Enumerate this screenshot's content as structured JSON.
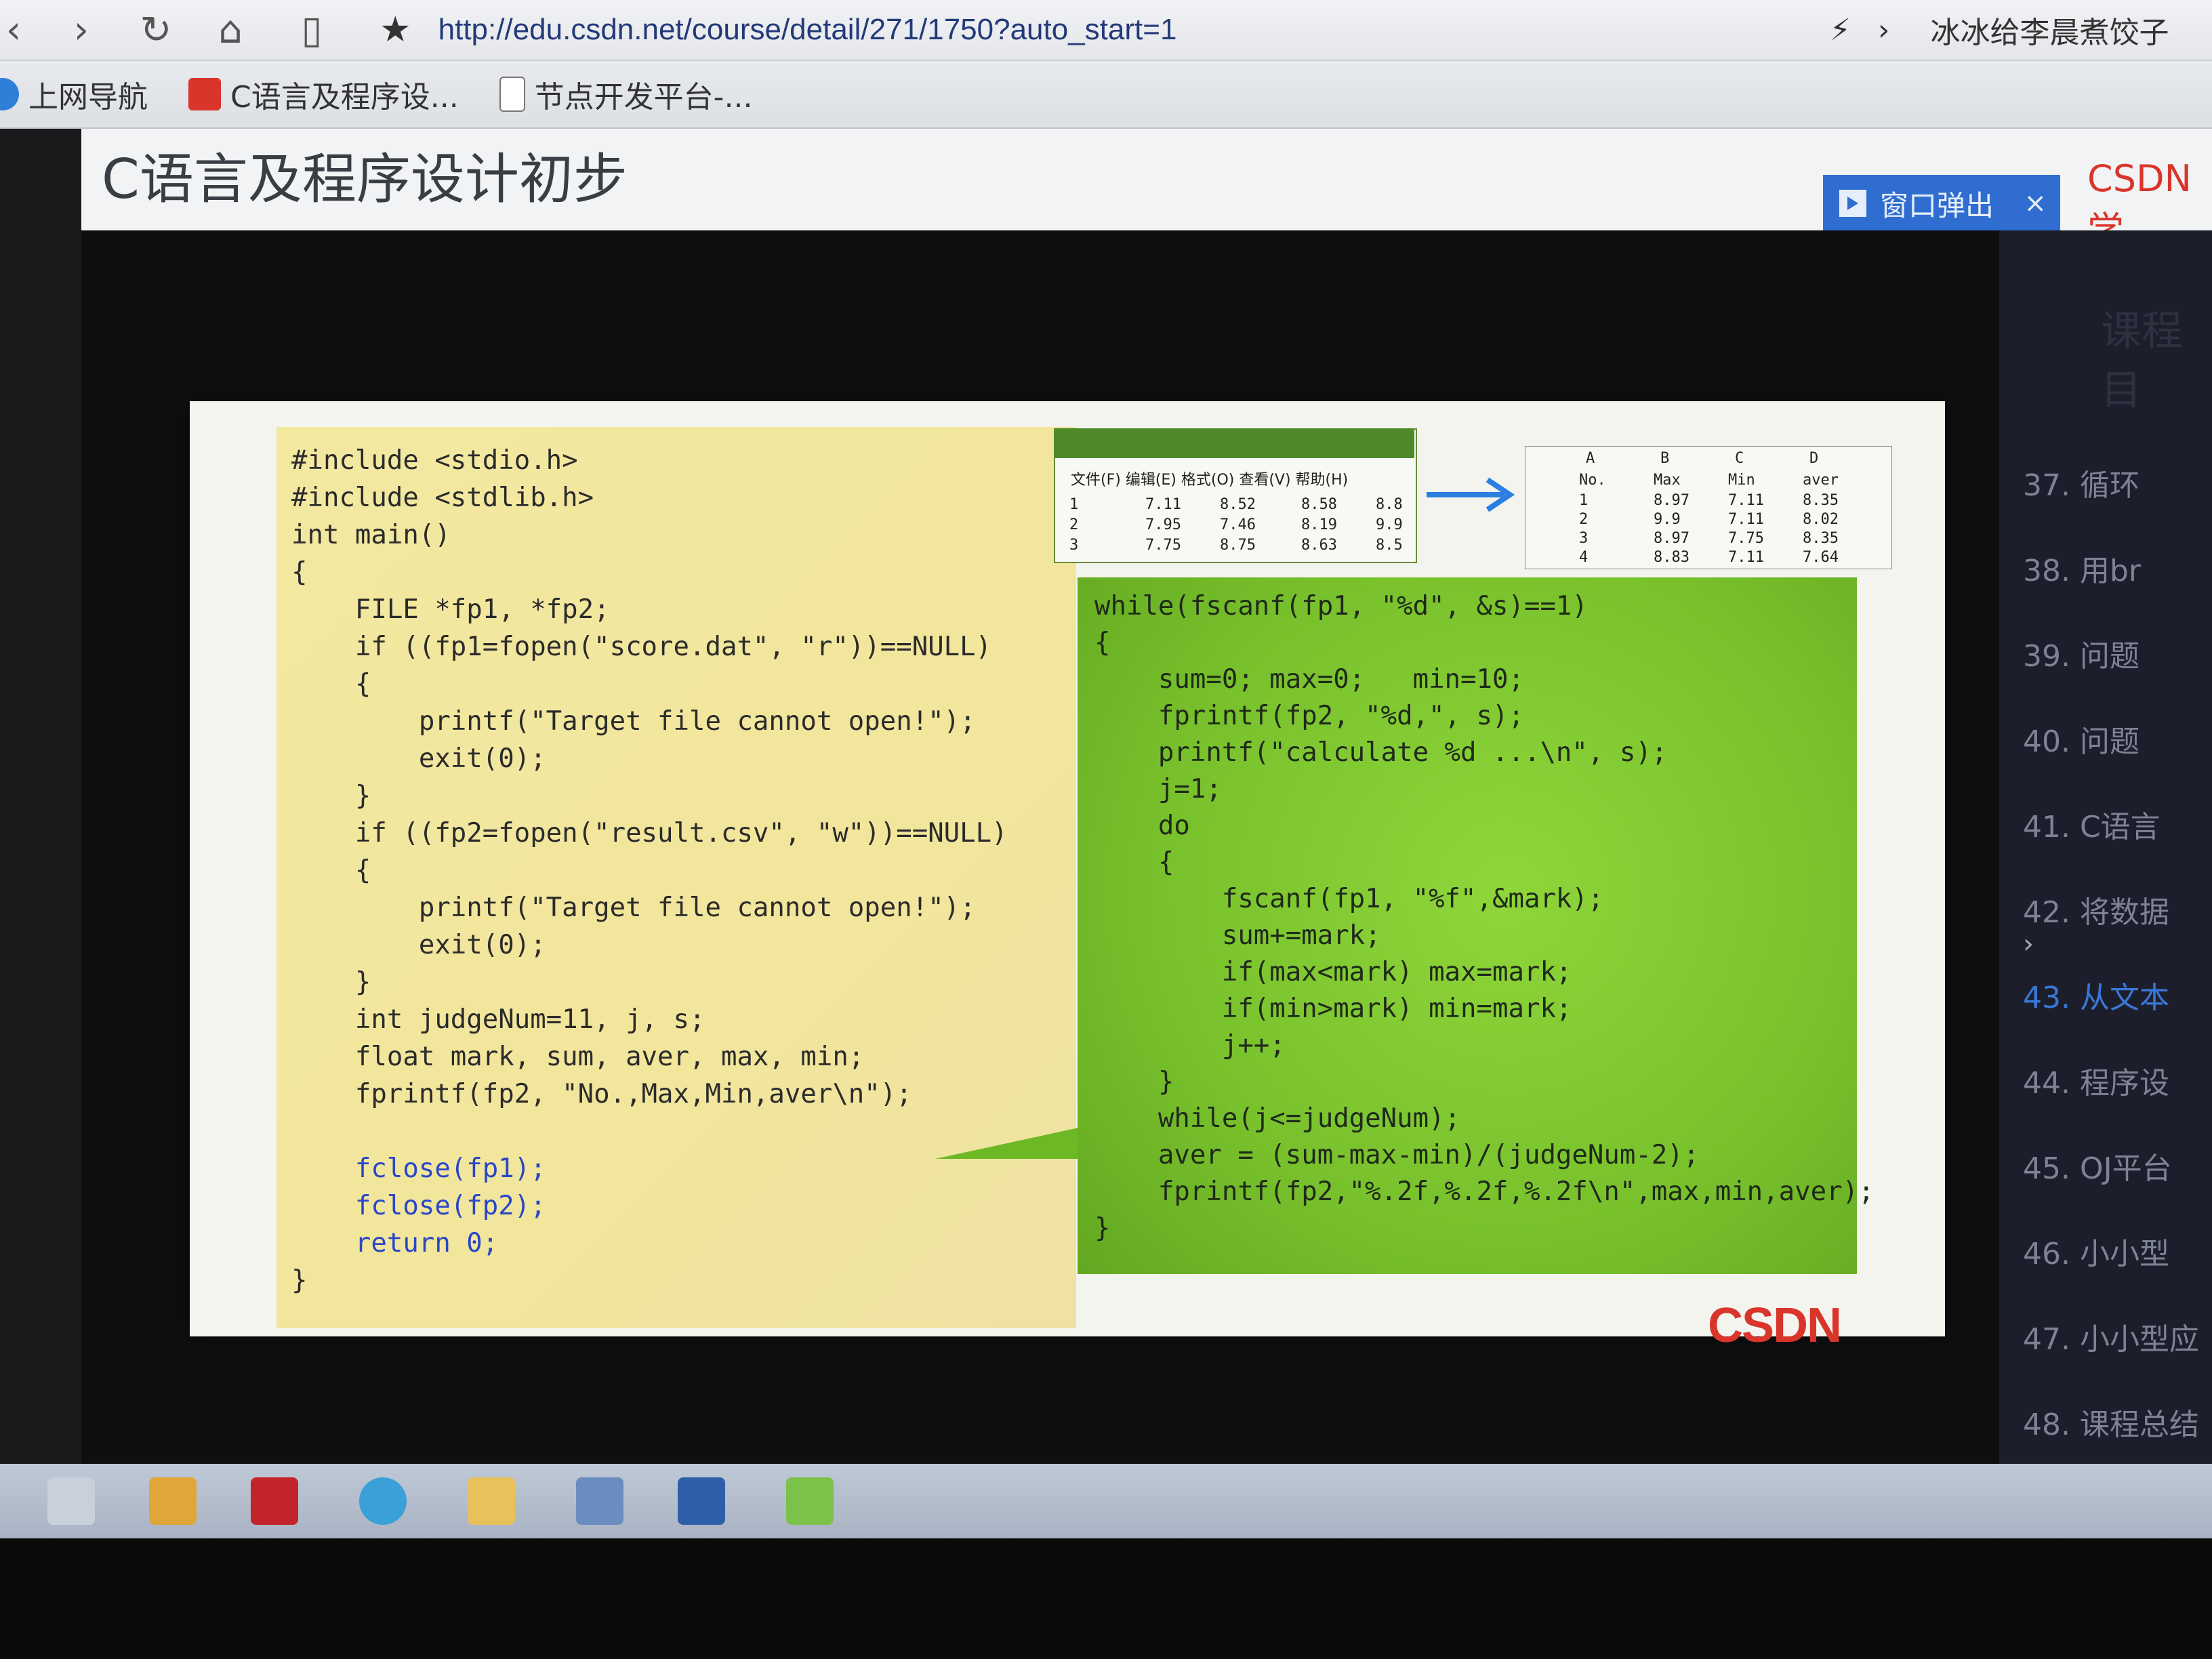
{
  "browser": {
    "url": "http://edu.csdn.net/course/detail/271/1750?auto_start=1",
    "right_text": "冰冰给李晨煮饺子",
    "bookmarks": [
      "上网导航",
      "C语言及程序设...",
      "节点开发平台-..."
    ]
  },
  "page": {
    "title": "C语言及程序设计初步",
    "popout_label": "窗口弹出",
    "popout_close": "×",
    "brand": "CSDN学",
    "faded_heading": "课程目"
  },
  "sidebar": {
    "items": [
      "37. 循环",
      "38. 用br",
      "39. 问题",
      "40. 问题",
      "41. C语言",
      "42. 将数据",
      "43. 从文本",
      "44. 程序设",
      "45. OJ平台",
      "46. 小小型",
      "47. 小小型应",
      "48. 课程总结"
    ],
    "active_index": 6
  },
  "slide": {
    "left_code": [
      "#include <stdio.h>",
      "#include <stdlib.h>",
      "int main()",
      "{",
      "    FILE *fp1, *fp2;",
      "    if ((fp1=fopen(\"score.dat\", \"r\"))==NULL)",
      "    {",
      "        printf(\"Target file cannot open!\");",
      "        exit(0);",
      "    }",
      "    if ((fp2=fopen(\"result.csv\", \"w\"))==NULL)",
      "    {",
      "        printf(\"Target file cannot open!\");",
      "        exit(0);",
      "    }",
      "    int judgeNum=11, j, s;",
      "    float mark, sum, aver, max, min;",
      "    fprintf(fp2, \"No.,Max,Min,aver\\n\");",
      "",
      "    fclose(fp1);",
      "    fclose(fp2);",
      "    return 0;",
      "}"
    ],
    "right_code": [
      "while(fscanf(fp1, \"%d\", &s)==1)",
      "{",
      "    sum=0; max=0;   min=10;",
      "    fprintf(fp2, \"%d,\", s);",
      "    printf(\"calculate %d ...\\n\", s);",
      "    j=1;",
      "    do",
      "    {",
      "        fscanf(fp1, \"%f\",&mark);",
      "        sum+=mark;",
      "        if(max<mark) max=mark;",
      "        if(min>mark) min=mark;",
      "        j++;",
      "    }",
      "    while(j<=judgeNum);",
      "    aver = (sum-max-min)/(judgeNum-2);",
      "    fprintf(fp2,\"%.2f,%.2f,%.2f\\n\",max,min,aver);",
      "}"
    ],
    "sheet_left": {
      "menu": "文件(F)   编辑(E)   格式(O)   查看(V)   帮助(H)",
      "rows": [
        [
          "1",
          "7.11",
          "8.52",
          "8.58",
          "8.8"
        ],
        [
          "2",
          "7.95",
          "7.46",
          "8.19",
          "9.9"
        ],
        [
          "3",
          "7.75",
          "8.75",
          "8.63",
          "8.5"
        ]
      ]
    },
    "sheet_right": {
      "header": [
        "A",
        "B",
        "C",
        "D"
      ],
      "col_labels": [
        "No.",
        "Max",
        "Min",
        "aver"
      ],
      "rows": [
        [
          "1",
          "8.97",
          "7.11",
          "8.35"
        ],
        [
          "2",
          "9.9",
          "7.11",
          "8.02"
        ],
        [
          "3",
          "8.97",
          "7.75",
          "8.35"
        ],
        [
          "4",
          "8.83",
          "7.11",
          "7.64"
        ]
      ]
    },
    "logo": "CSDN"
  },
  "colors": {
    "slide_yellow": "#f3e8a0",
    "slide_green": "#78c12c",
    "code_blue": "#2a47c9",
    "csdn_red": "#d9352b"
  }
}
